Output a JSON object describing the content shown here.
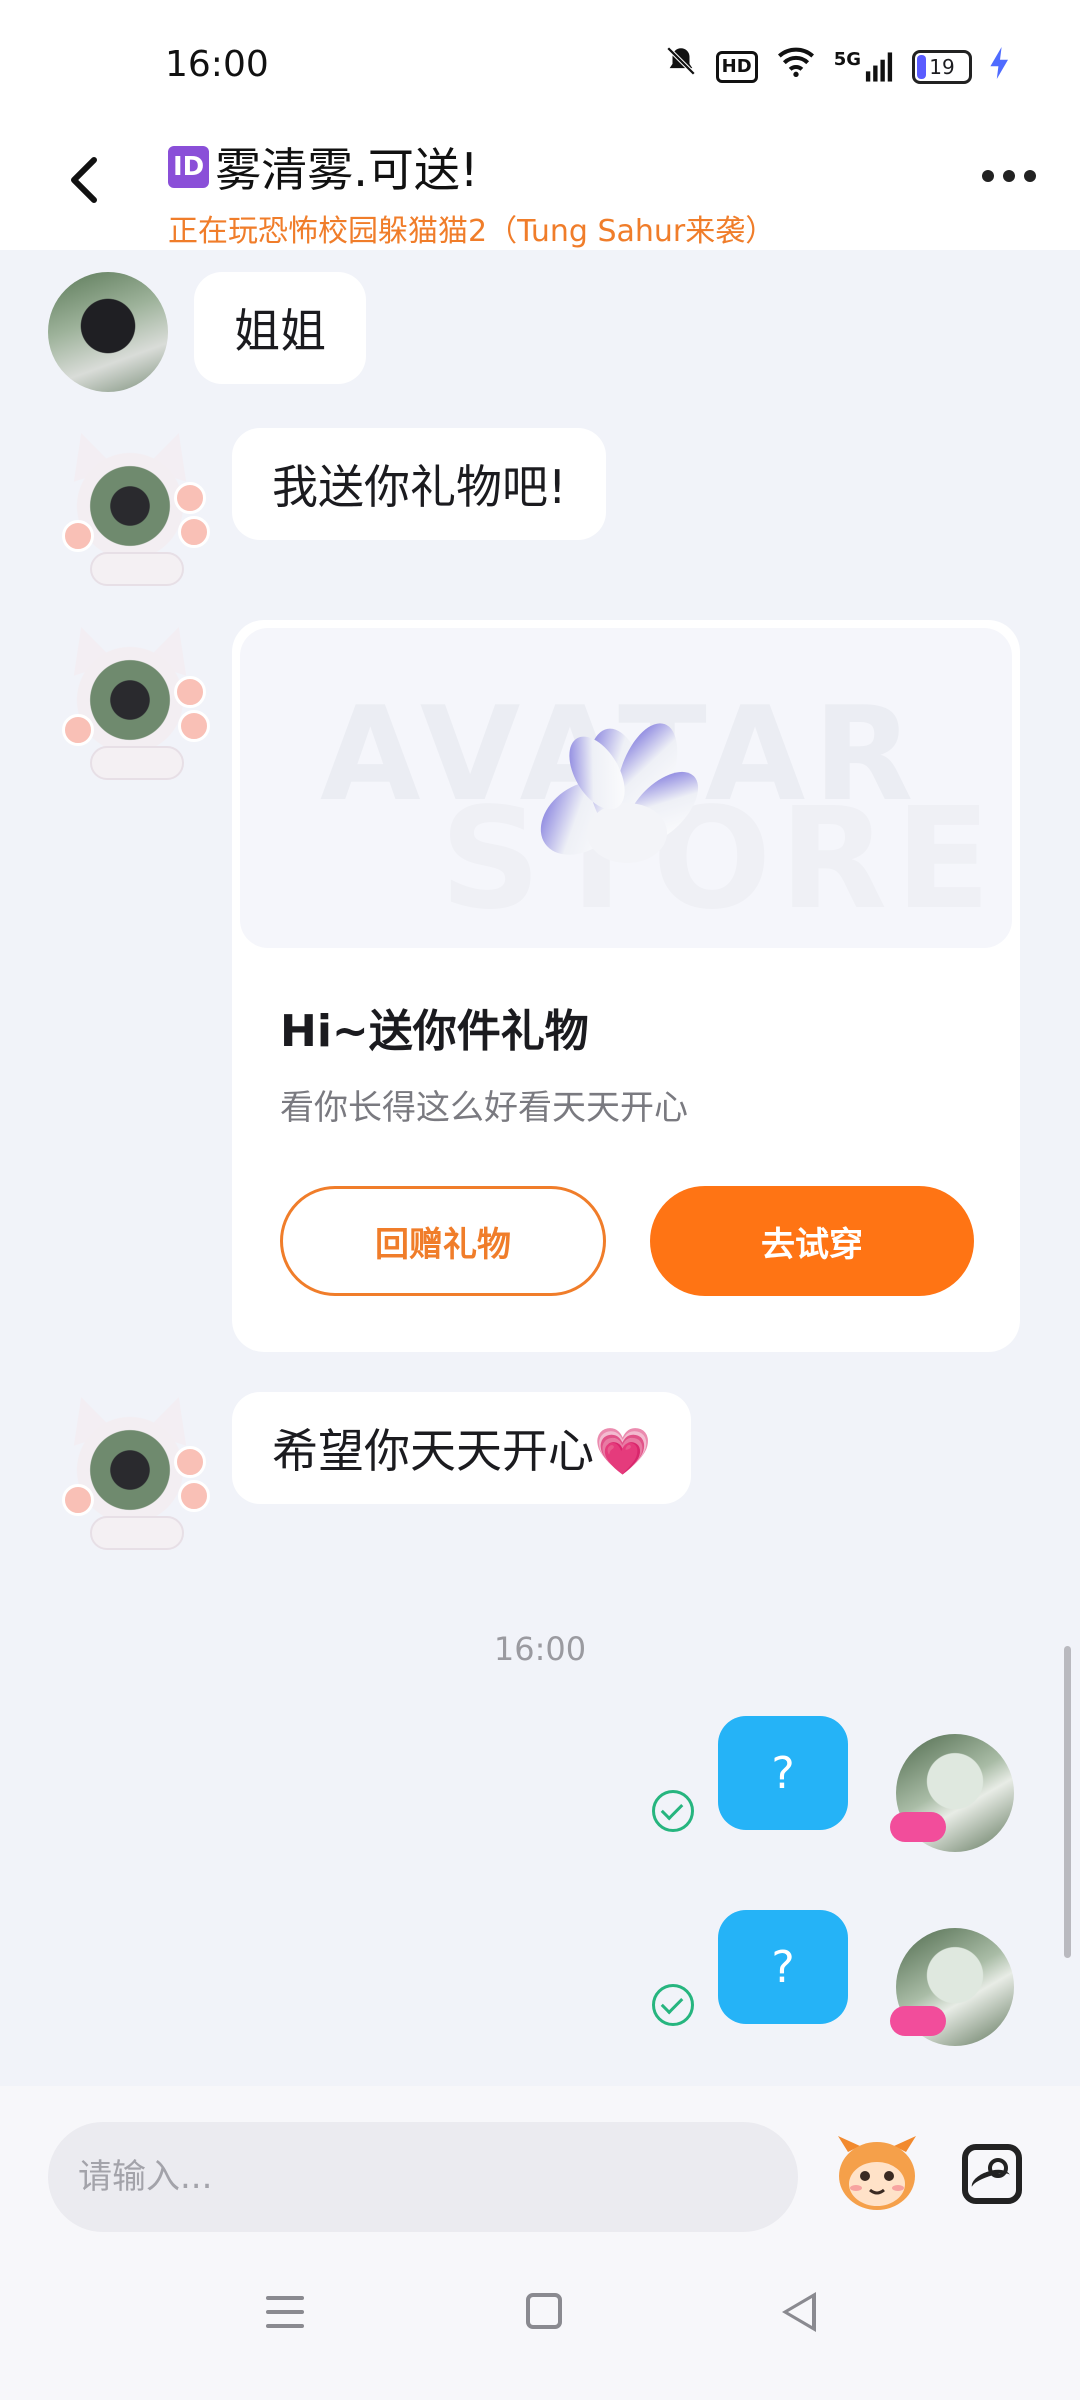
{
  "status_bar": {
    "time": "16:00",
    "hd_label": "HD",
    "network_label": "5G",
    "battery_level": "19",
    "icons": [
      "bell-muted-icon",
      "hd-icon",
      "wifi-icon",
      "signal-icon",
      "battery-icon",
      "charging-icon"
    ]
  },
  "header": {
    "id_badge": "ID",
    "title": "雾清雾.可送!",
    "subtitle": "正在玩恐怖校园躲猫猫2（Tung Sahur来袭）"
  },
  "messages": [
    {
      "from": "other",
      "text": "姐姐"
    },
    {
      "from": "other",
      "text": "我送你礼物吧!"
    },
    {
      "from": "other",
      "text": "希望你天天开心💗"
    }
  ],
  "gift_card": {
    "watermark_top": "AVATAR",
    "watermark_bottom": "STORE",
    "title": "Hi~送你件礼物",
    "description": "看你长得这么好看天天开心",
    "return_gift_label": "回赠礼物",
    "try_on_label": "去试穿",
    "accent_color": "#ff7414"
  },
  "timestamp": "16:00",
  "my_messages": [
    {
      "text": "?",
      "status": "sent"
    },
    {
      "text": "?",
      "status": "sent"
    }
  ],
  "input": {
    "placeholder": "请输入..."
  },
  "colors": {
    "my_bubble": "#25b3f7",
    "subtitle": "#f07d2a",
    "check": "#26b57f"
  }
}
